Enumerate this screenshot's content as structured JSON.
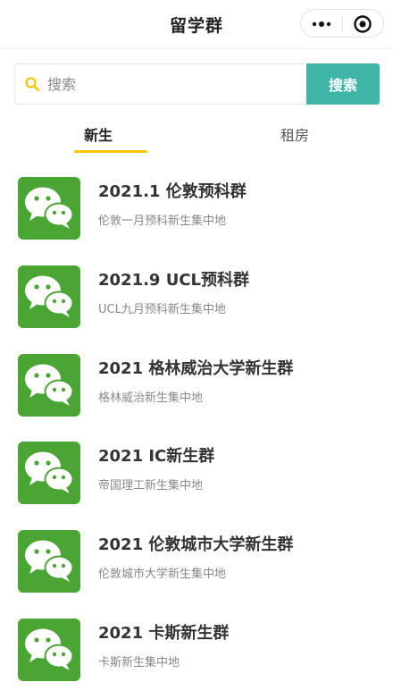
{
  "navbar": {
    "title": "留学群",
    "more_icon": "more-dots-icon",
    "target_icon": "target-circle-icon"
  },
  "search": {
    "placeholder": "搜索",
    "button_label": "搜索",
    "icon": "search-icon",
    "accent_color": "#3fb5a8",
    "icon_color": "#f5c500"
  },
  "tabs": [
    {
      "label": "新生",
      "active": true
    },
    {
      "label": "租房",
      "active": false
    }
  ],
  "tab_indicator_color": "#f5c500",
  "groups": [
    {
      "title": "2021.1 伦敦预科群",
      "description": "伦敦一月预科新生集中地",
      "icon": "wechat-icon"
    },
    {
      "title": "2021.9 UCL预科群",
      "description": "UCL九月预科新生集中地",
      "icon": "wechat-icon"
    },
    {
      "title": "2021 格林威治大学新生群",
      "description": "格林威治新生集中地",
      "icon": "wechat-icon"
    },
    {
      "title": "2021 IC新生群",
      "description": "帝国理工新生集中地",
      "icon": "wechat-icon"
    },
    {
      "title": "2021 伦敦城市大学新生群",
      "description": "伦敦城市大学新生集中地",
      "icon": "wechat-icon"
    },
    {
      "title": "2021 卡斯新生群",
      "description": "卡斯新生集中地",
      "icon": "wechat-icon"
    }
  ],
  "wechat_green": "#4ba534"
}
